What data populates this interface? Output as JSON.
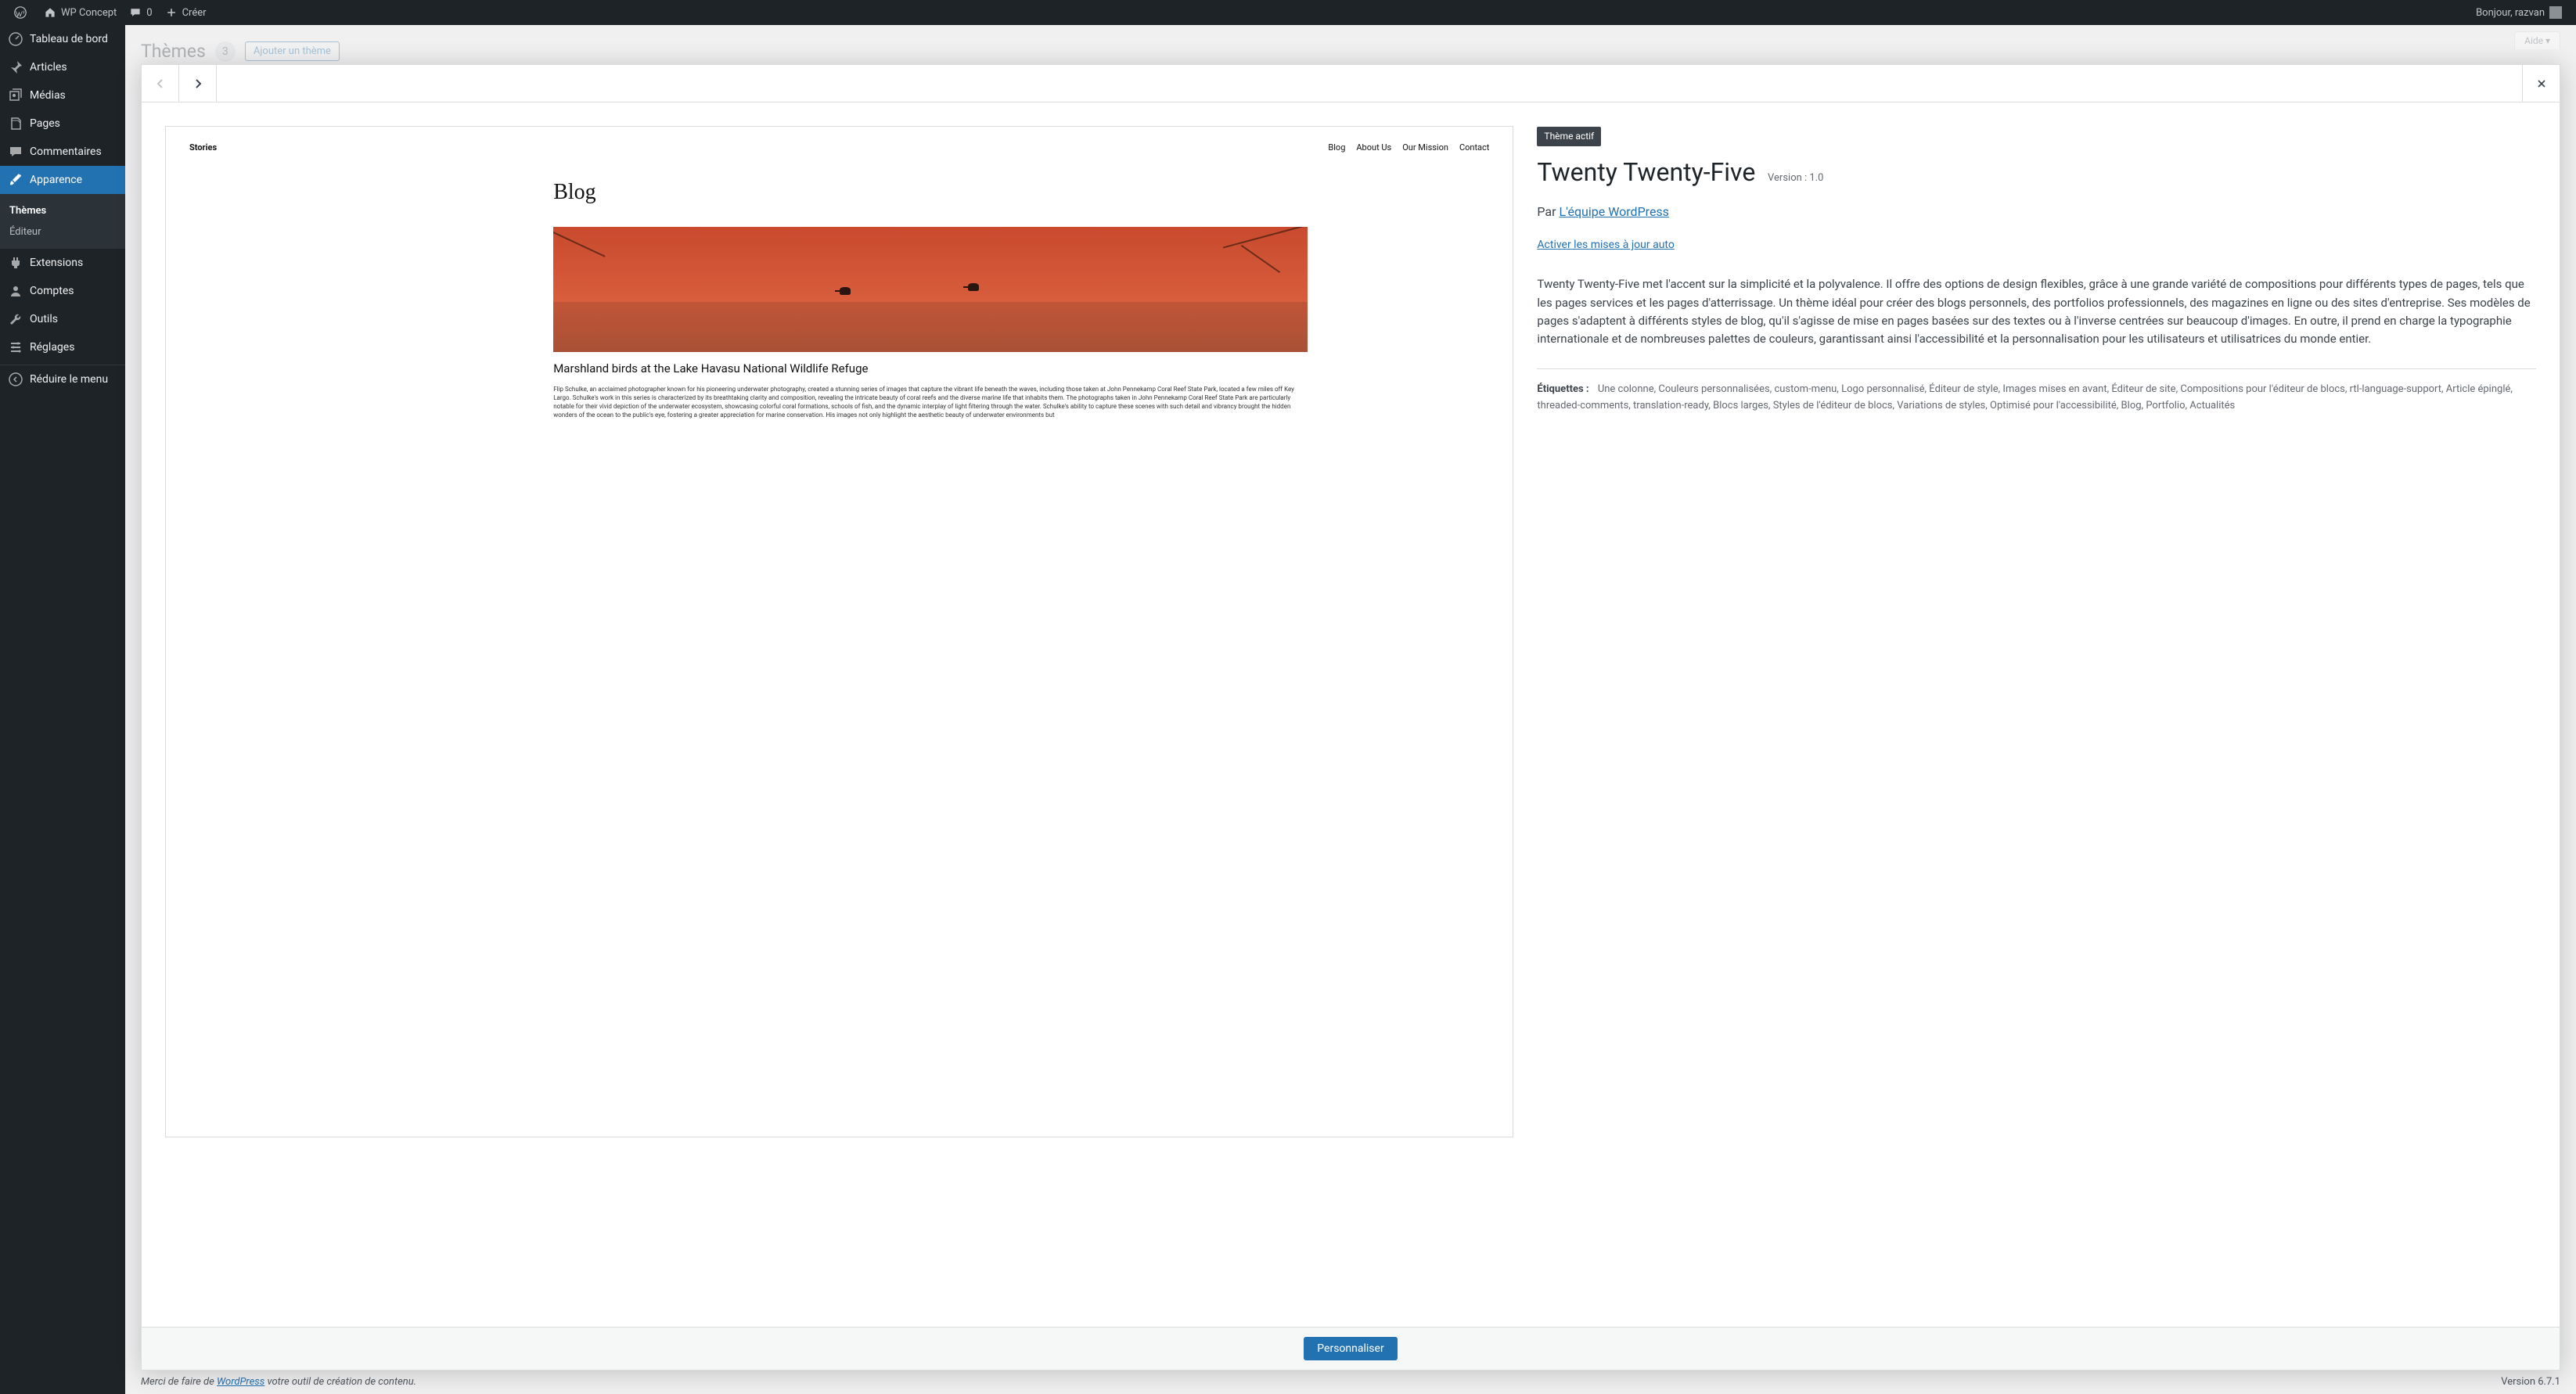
{
  "adminBar": {
    "siteName": "WP Concept",
    "comments": "0",
    "create": "Créer",
    "greeting": "Bonjour, razvan"
  },
  "sidebar": {
    "dashboard": "Tableau de bord",
    "posts": "Articles",
    "media": "Médias",
    "pages": "Pages",
    "comments": "Commentaires",
    "appearance": "Apparence",
    "appearance_sub": {
      "themes": "Thèmes",
      "editor": "Éditeur"
    },
    "plugins": "Extensions",
    "users": "Comptes",
    "tools": "Outils",
    "settings": "Réglages",
    "collapse": "Réduire le menu"
  },
  "pageHeader": {
    "title": "Thèmes",
    "count": "3",
    "addNew": "Ajouter un thème",
    "help": "Aide ▾"
  },
  "screenshot": {
    "site": "Stories",
    "nav": [
      "Blog",
      "About Us",
      "Our Mission",
      "Contact"
    ],
    "heading": "Blog",
    "postTitle": "Marshland birds at the Lake Havasu National Wildlife Refuge",
    "postBody": "Flip Schulke, an acclaimed photographer known for his pioneering underwater photography, created a stunning series of images that capture the vibrant life beneath the waves, including those taken at John Pennekamp Coral Reef State Park, located a few miles off Key Largo. Schulke's work in this series is characterized by its breathtaking clarity and composition, revealing the intricate beauty of coral reefs and the diverse marine life that inhabits them. The photographs taken in John Pennekamp Coral Reef State Park are particularly notable for their vivid depiction of the underwater ecosystem, showcasing colorful coral formations, schools of fish, and the dynamic interplay of light filtering through the water. Schulke's ability to capture these scenes with such detail and vibrancy brought the hidden wonders of the ocean to the public's eye, fostering a greater appreciation for marine conservation. His images not only highlight the aesthetic beauty of underwater environments but"
  },
  "theme": {
    "activeBadge": "Thème actif",
    "name": "Twenty Twenty-Five",
    "versionLabel": "Version : 1.0",
    "by": "Par",
    "author": "L'équipe WordPress",
    "autoUpdate": "Activer les mises à jour auto",
    "description": "Twenty Twenty-Five met l'accent sur la simplicité et la polyvalence. Il offre des options de design flexibles, grâce à une grande variété de compositions pour différents types de pages, tels que les pages services et les pages d'atterrissage. Un thème idéal pour créer des blogs personnels, des portfolios professionnels, des magazines en ligne ou des sites d'entreprise. Ses modèles de pages s'adaptent à différents styles de blog, qu'il s'agisse de mise en pages basées sur des textes ou à l'inverse centrées sur beaucoup d'images. En outre, il prend en charge la typographie internationale et de nombreuses palettes de couleurs, garantissant ainsi l'accessibilité et la personnalisation pour les utilisateurs et utilisatrices du monde entier.",
    "tagsLabel": "Étiquettes :",
    "tags": "Une colonne, Couleurs personnalisées, custom-menu, Logo personnalisé, Éditeur de style, Images mises en avant, Éditeur de site, Compositions pour l'éditeur de blocs, rtl-language-support, Article épinglé, threaded-comments, translation-ready, Blocs larges, Styles de l'éditeur de blocs, Variations de styles, Optimisé pour l'accessibilité, Blog, Portfolio, Actualités",
    "customize": "Personnaliser"
  },
  "footer": {
    "thanksPrefix": "Merci de faire de ",
    "wp": "WordPress",
    "thanksSuffix": " votre outil de création de contenu.",
    "version": "Version 6.7.1"
  }
}
